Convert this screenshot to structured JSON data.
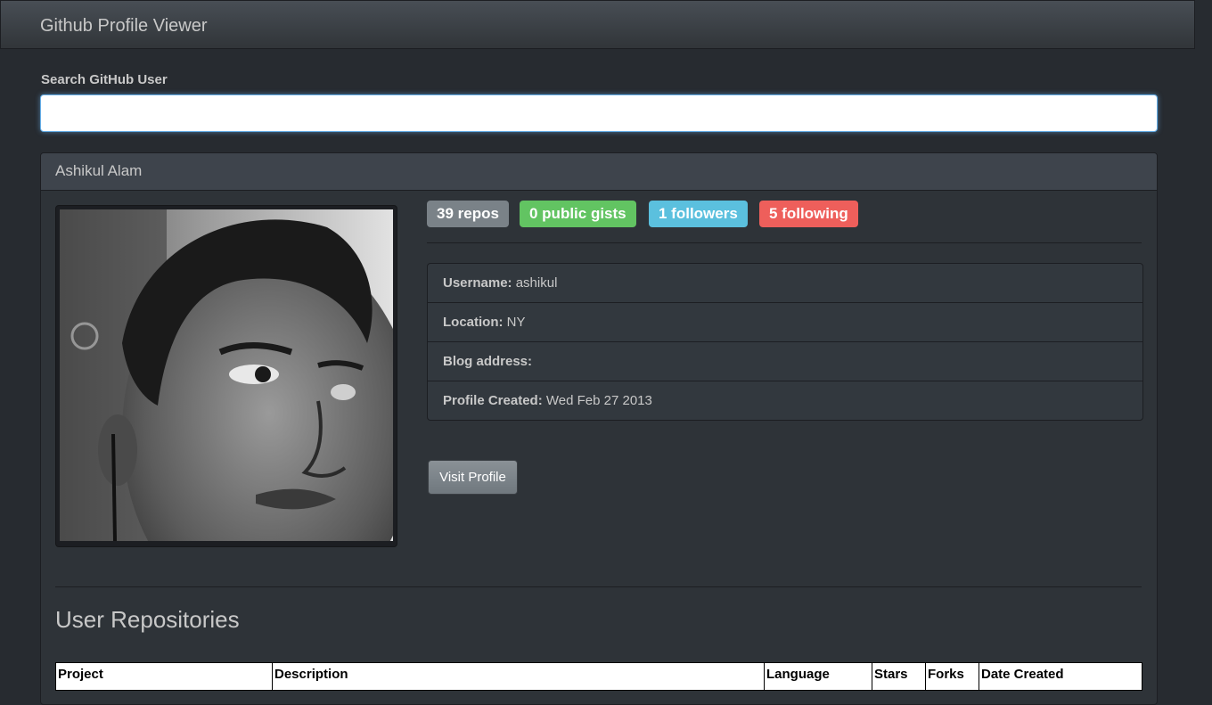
{
  "app": {
    "title": "Github Profile Viewer"
  },
  "search": {
    "label": "Search GitHub User",
    "value": "",
    "placeholder": ""
  },
  "profile": {
    "name": "Ashikul Alam",
    "badges": {
      "repos": "39 repos",
      "gists": "0 public gists",
      "followers": "1 followers",
      "following": "5 following"
    },
    "details": [
      {
        "label": "Username:",
        "value": "ashikul"
      },
      {
        "label": "Location:",
        "value": "NY"
      },
      {
        "label": "Blog address:",
        "value": ""
      },
      {
        "label": "Profile Created:",
        "value": "Wed Feb 27 2013"
      }
    ],
    "visit_label": "Visit Profile"
  },
  "repos": {
    "heading": "User Repositories",
    "columns": [
      "Project",
      "Description",
      "Language",
      "Stars",
      "Forks",
      "Date Created"
    ]
  },
  "colors": {
    "background": "#272b30",
    "badge_repos": "#7a8288",
    "badge_gists": "#62c462",
    "badge_followers": "#5bc0de",
    "badge_following": "#ee5f5b"
  }
}
